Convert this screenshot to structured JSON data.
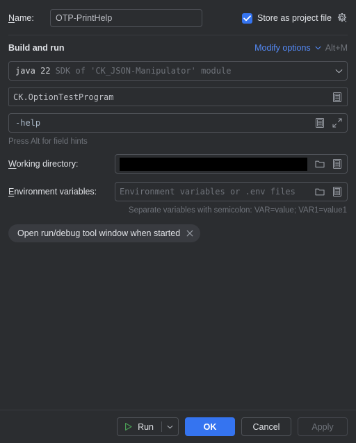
{
  "dialog": {
    "name_row": {
      "label": "Name:",
      "mnemonic": "N",
      "label_rest": "ame:",
      "value": "OTP-PrintHelp",
      "store_checkbox_label": "Store as project file",
      "store_checked": true,
      "gear_icon": "gear-icon"
    },
    "build_and_run": {
      "title": "Build and run",
      "modify_options_label": "Modify options",
      "modify_options_shortcut": "Alt+M",
      "chevron_icon": "chevron-down-icon",
      "sdk": {
        "name": "java 22",
        "description": "SDK of 'CK_JSON-Manipulator' module",
        "dropdown_icon": "chevron-down-icon"
      },
      "main_class": {
        "value": "CK.OptionTestProgram",
        "icon": "list-document-icon"
      },
      "program_arguments": {
        "value": "-help",
        "icons": [
          "list-document-icon",
          "expand-icon"
        ]
      },
      "hint": "Press Alt for field hints"
    },
    "working_directory": {
      "label": "Working directory:",
      "mnemonic": "W",
      "label_rest": "orking directory:",
      "value": "",
      "redacted": true,
      "icons": [
        "folder-icon",
        "list-document-icon"
      ]
    },
    "environment_variables": {
      "label": "Environment variables:",
      "mnemonic": "E",
      "label_rest": "nvironment variables:",
      "value": "",
      "placeholder": "Environment variables or .env files",
      "icons": [
        "folder-icon",
        "list-document-icon"
      ],
      "hint": "Separate variables with semicolon: VAR=value; VAR1=value1"
    },
    "option_chips": [
      {
        "label": "Open run/debug tool window when started",
        "close_icon": "close-icon"
      }
    ],
    "footer": {
      "run_button": {
        "label": "Run",
        "play_icon": "play-icon",
        "arrow_icon": "chevron-down-icon"
      },
      "ok_button": "OK",
      "cancel_button": "Cancel",
      "apply_button": "Apply",
      "apply_enabled": false
    }
  },
  "colors": {
    "background": "#2b2d30",
    "accent_blue": "#3574f0",
    "link_blue": "#548af7",
    "text": "#dfe1e5",
    "muted_text": "#6f737a",
    "border": "#4e5157",
    "chip_background": "#393b40",
    "play_green": "#499c54",
    "redaction": "#000000"
  }
}
